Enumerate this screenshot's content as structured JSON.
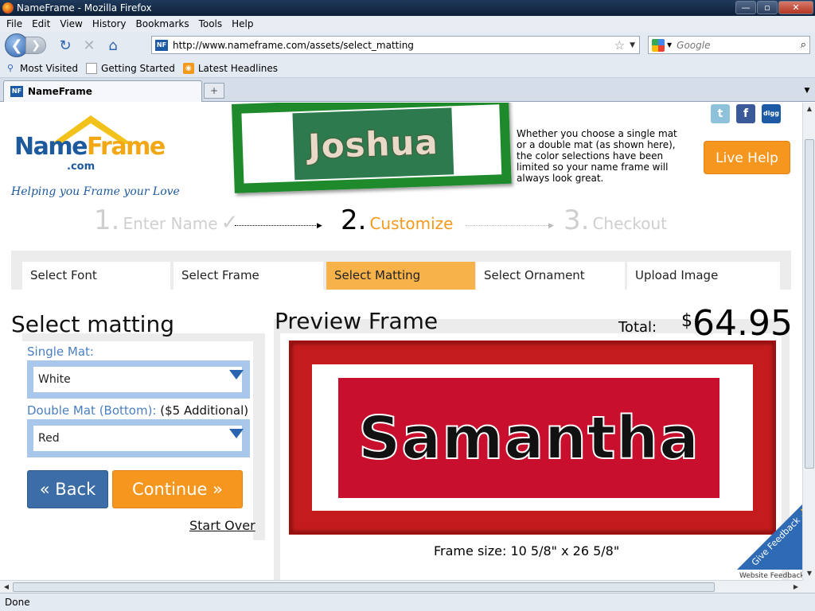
{
  "window": {
    "title": "NameFrame - Mozilla Firefox",
    "minimize": "—",
    "maximize": "▫",
    "close": "✕"
  },
  "menu": [
    "File",
    "Edit",
    "View",
    "History",
    "Bookmarks",
    "Tools",
    "Help"
  ],
  "nav": {
    "url": "http://www.nameframe.com/assets/select_matting",
    "search_placeholder": "Google",
    "favicon_text": "NF"
  },
  "bookmarks": [
    "Most Visited",
    "Getting Started",
    "Latest Headlines"
  ],
  "tab": {
    "label": "NameFrame"
  },
  "logo": {
    "name_part1": "Name",
    "name_part2": "Frame",
    "domain": ".com",
    "tagline": "Helping you Frame your Love"
  },
  "banner": {
    "sample_name": "Joshua",
    "intro_text": "Whether you choose a single mat or a double mat (as shown here), the color selections have been limited so your name frame will always look great."
  },
  "social": {
    "twitter": "t",
    "facebook": "f",
    "digg": "digg"
  },
  "live_help": "Live Help",
  "steps": [
    {
      "num": "1.",
      "label": "Enter Name",
      "state": "done"
    },
    {
      "num": "2.",
      "label": "Customize",
      "state": "active"
    },
    {
      "num": "3.",
      "label": "Checkout",
      "state": "pending"
    }
  ],
  "step_tabs": [
    "Select Font",
    "Select Frame",
    "Select Matting",
    "Select Ornament",
    "Upload Image"
  ],
  "matting": {
    "title": "Select matting",
    "single_label": "Single Mat:",
    "single_value": "White",
    "double_label": "Double Mat (Bottom):",
    "double_extra": "($5 Additional)",
    "double_value": "Red",
    "back_label": "« Back",
    "continue_label": "Continue »",
    "start_over": "Start Over"
  },
  "preview": {
    "title": "Preview Frame",
    "total_label": "Total:",
    "currency": "$",
    "total_amount": "64.95",
    "name": "Samantha",
    "frame_size": "Frame size: 10 5/8\" x 26 5/8\""
  },
  "feedback": {
    "label": "Give Feedback",
    "caption": "Website Feedback"
  },
  "status": "Done",
  "colors": {
    "brand_blue": "#1d5a9d",
    "brand_orange": "#f5961f",
    "active_tab": "#f8b24a",
    "mat_red": "#c8102e",
    "frame_red": "#c41c1c"
  }
}
